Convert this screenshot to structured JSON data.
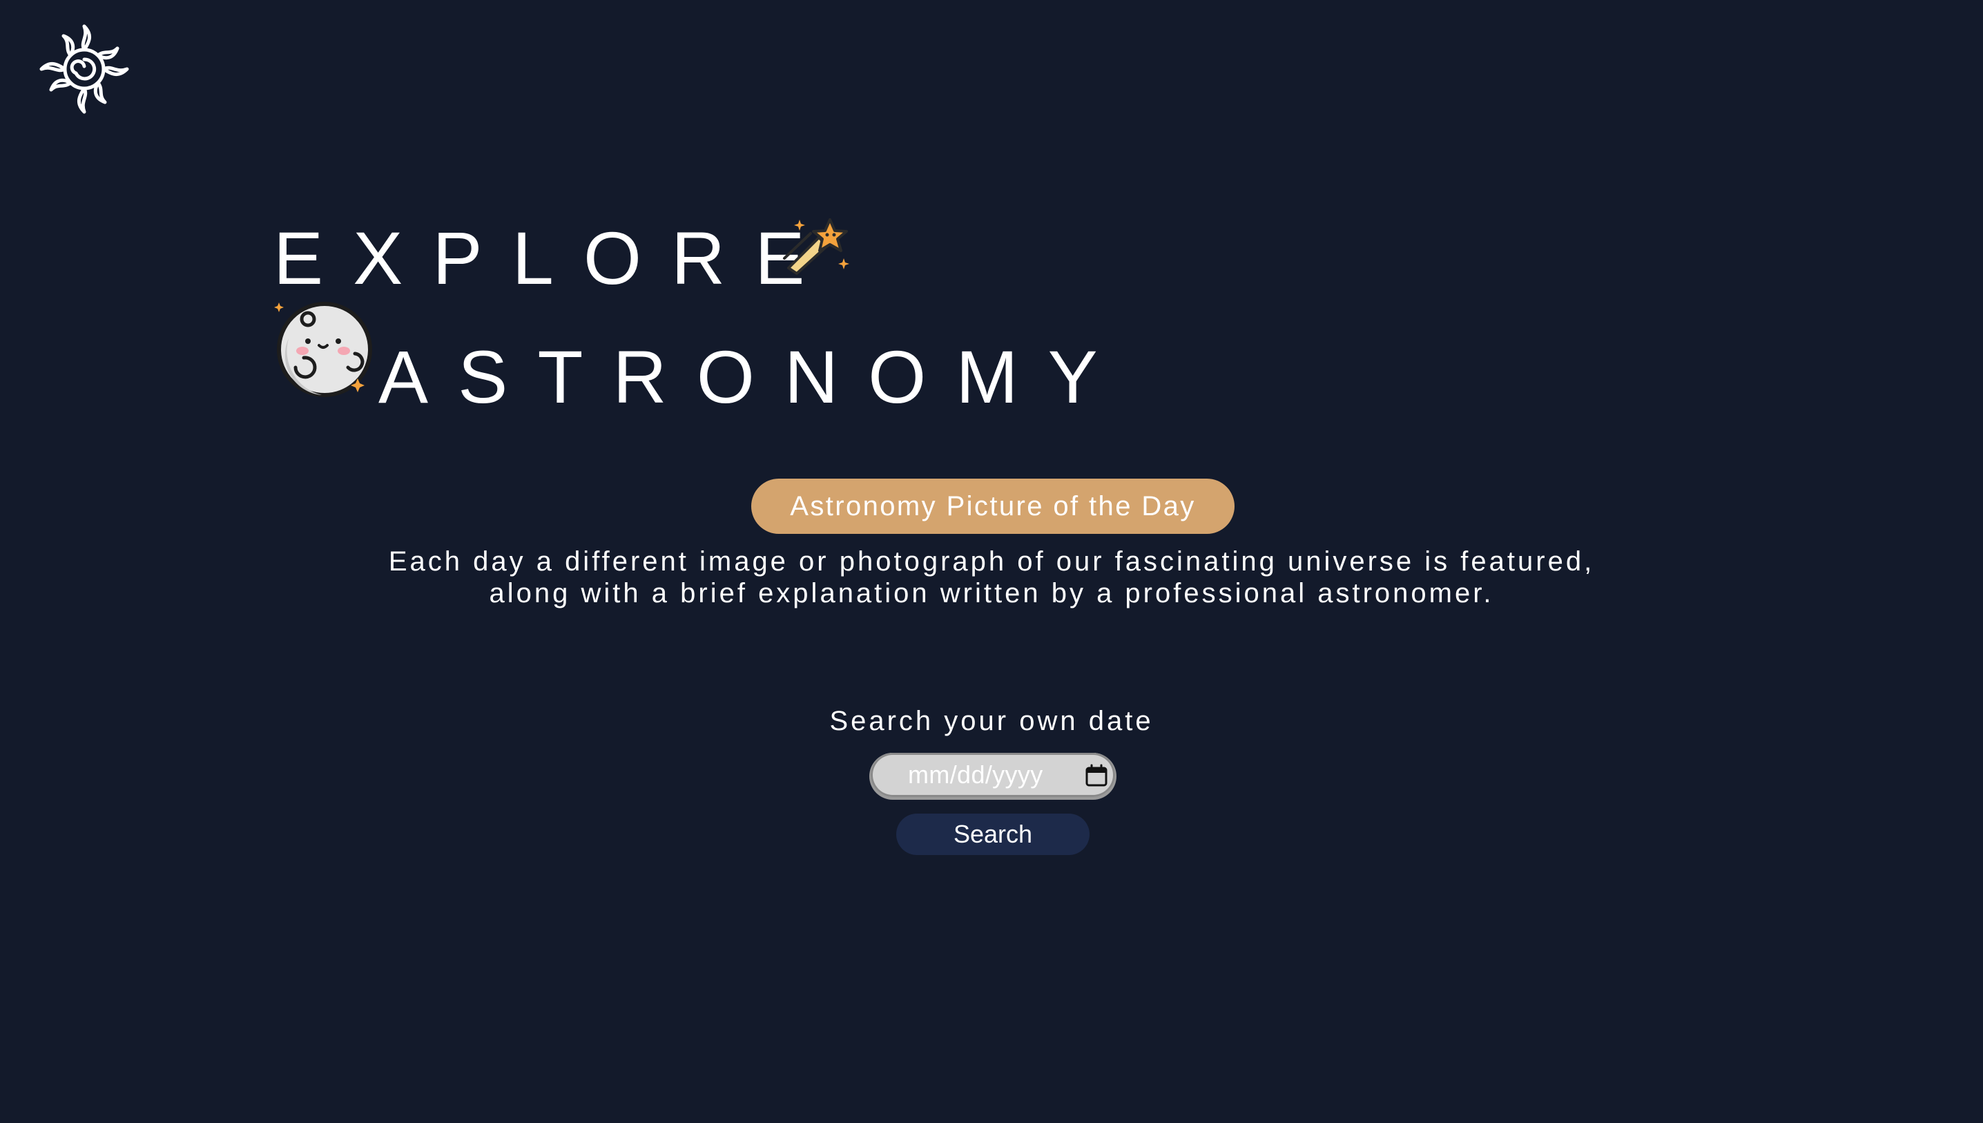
{
  "colors": {
    "background": "#131a2b",
    "accent": "#d4a46e",
    "search_button": "#1d2a4a",
    "date_field": "#d3d3d3"
  },
  "logo": {
    "icon": "sun-icon"
  },
  "hero": {
    "line1": "EXPLORE",
    "line2": "ASTRONOMY",
    "icons": [
      "shooting-star-icon",
      "moon-icon"
    ]
  },
  "apod_button": {
    "label": "Astronomy Picture of the Day"
  },
  "description": {
    "line1": "Each day a different image or photograph of our fascinating universe is featured,",
    "line2": "along with a brief explanation written by a professional astronomer."
  },
  "search": {
    "label": "Search your own date",
    "date_placeholder": "mm/dd/yyyy",
    "button_label": "Search",
    "calendar_icon": "calendar-icon"
  }
}
